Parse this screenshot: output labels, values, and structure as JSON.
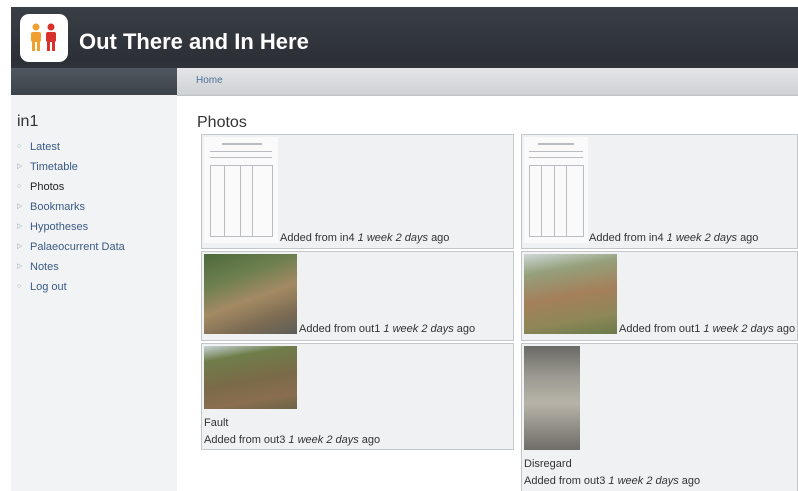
{
  "site": {
    "title": "Out There and In Here",
    "logo_icon": "two-people-icon"
  },
  "breadcrumb": {
    "home": "Home"
  },
  "sidebar": {
    "title": "in1",
    "items": [
      {
        "label": "Latest",
        "current": false
      },
      {
        "label": "Timetable",
        "current": false
      },
      {
        "label": "Photos",
        "current": true
      },
      {
        "label": "Bookmarks",
        "current": false
      },
      {
        "label": "Hypotheses",
        "current": false
      },
      {
        "label": "Palaeocurrent Data",
        "current": false
      },
      {
        "label": "Notes",
        "current": false
      },
      {
        "label": "Log out",
        "current": false
      }
    ]
  },
  "main": {
    "title": "Photos",
    "photos": [
      {
        "prefix": "Added from in4",
        "time": "1 week 2 days",
        "suffix": "ago",
        "label": ""
      },
      {
        "prefix": "Added from in4",
        "time": "1 week 2 days",
        "suffix": "ago",
        "label": ""
      },
      {
        "prefix": "Added from out1",
        "time": "1 week 2 days",
        "suffix": "ago",
        "label": ""
      },
      {
        "prefix": "Added from out1",
        "time": "1 week 2 days",
        "suffix": "ago",
        "label": ""
      },
      {
        "prefix": "Added from out3",
        "time": "1 week 2 days",
        "suffix": "ago",
        "label": "Fault"
      },
      {
        "prefix": "Added from out3",
        "time": "1 week 2 days",
        "suffix": "ago",
        "label": "Disregard"
      }
    ]
  },
  "colors": {
    "header": "#2c3036",
    "nav_link": "#3a5a86",
    "card": "#f0f1f2"
  }
}
